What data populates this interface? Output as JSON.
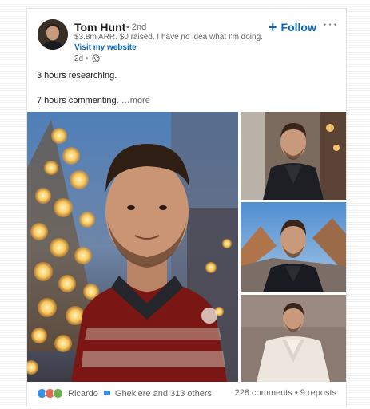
{
  "post": {
    "author": {
      "name": "Tom Hunt",
      "degree": "• 2nd",
      "headline": "$3.8m ARR. $0 raised. I have no idea what I'm doing.",
      "link": "Visit my website",
      "time": "2d •"
    },
    "actions": {
      "follow_label": "Follow",
      "more_icon": "···"
    },
    "body": {
      "line1": "3 hours researching.",
      "line2": "7 hours commenting.",
      "more": "…more"
    },
    "footer": {
      "reactors": "Ricardo",
      "reactors_rest": "Ghekiere and 313 others",
      "comments": "228 comments",
      "separator": " • ",
      "reposts": "9 reposts"
    }
  },
  "colors": {
    "accent": "#0a66c2",
    "muted": "#666666",
    "text": "#1a1a1a"
  },
  "icons": [
    "globe-icon",
    "plus-icon",
    "more-icon",
    "comment-bubble-icon",
    "reaction-like-icon",
    "reaction-celebrate-icon",
    "reaction-support-icon"
  ]
}
